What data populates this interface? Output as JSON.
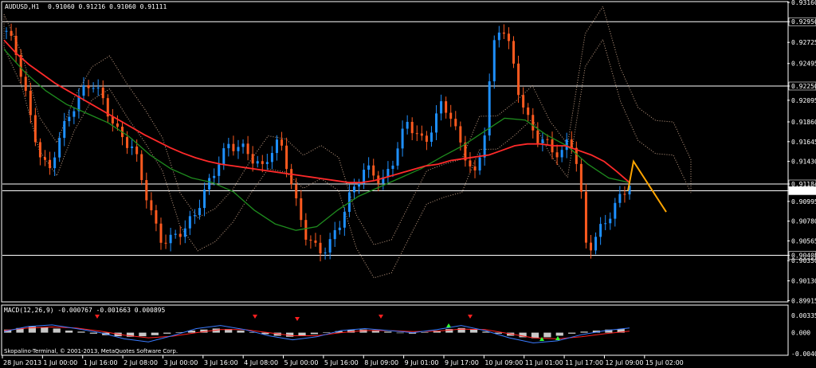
{
  "window": {
    "symbol_title": "AUDUSD,H1",
    "ohlc": "0.91060 0.91216 0.91060 0.91111",
    "macd_title": "MACD(12,26,9) -0.000767 -0.001663 0.000895",
    "copyright": "Skopalino-Terminal, © 2001-2013, MetaQuotes Software Corp."
  },
  "colors": {
    "background": "#000000",
    "candle_bull": "#1E90FF",
    "candle_bear": "#FF5A1F",
    "ma_fast": "#FF2A2A",
    "ma_slow": "#1E8C1E",
    "cloud": "#F4C7A8",
    "projection": "#FFA500",
    "macd_hist": "#C8C8C8",
    "macd_main": "#3A7BFF",
    "macd_signal": "#FF2020",
    "arrow_up": "#33FF33",
    "arrow_down": "#FF2020",
    "grid": "#FFFFFF"
  },
  "chart_data": [
    {
      "type": "candlestick",
      "ylim": [
        0.8991,
        0.9316
      ],
      "y_ticks": [
        "0.93160",
        "0.92950",
        "0.92725",
        "0.92495",
        "0.92250",
        "0.92095",
        "0.91860",
        "0.91645",
        "0.91430",
        "0.91184",
        "0.91111",
        "0.90995",
        "0.90780",
        "0.90565",
        "0.90408",
        "0.90350",
        "0.90130",
        "0.89915"
      ],
      "current_price": 0.91111,
      "horizontal_levels": [
        0.9295,
        0.9225,
        0.91184,
        0.9111,
        0.90408
      ],
      "x_ticks": [
        "28 Jun 2013",
        "1 Jul 00:00",
        "1 Jul 16:00",
        "2 Jul 08:00",
        "3 Jul 00:00",
        "3 Jul 16:00",
        "4 Jul 08:00",
        "5 Jul 00:00",
        "5 Jul 16:00",
        "8 Jul 09:00",
        "9 Jul 01:00",
        "9 Jul 17:00",
        "10 Jul 09:00",
        "11 Jul 01:00",
        "11 Jul 17:00",
        "12 Jul 09:00",
        "15 Jul 02:00"
      ],
      "close_path": [
        0.9285,
        0.9265,
        0.923,
        0.918,
        0.915,
        0.913,
        0.9165,
        0.9185,
        0.9205,
        0.922,
        0.923,
        0.9215,
        0.9195,
        0.9175,
        0.9165,
        0.9155,
        0.912,
        0.9085,
        0.906,
        0.9055,
        0.9065,
        0.907,
        0.9085,
        0.9105,
        0.9125,
        0.9145,
        0.916,
        0.916,
        0.9155,
        0.9145,
        0.9135,
        0.9155,
        0.9165,
        0.9135,
        0.9095,
        0.9065,
        0.905,
        0.9045,
        0.9055,
        0.9075,
        0.91,
        0.912,
        0.9135,
        0.913,
        0.912,
        0.9135,
        0.9165,
        0.9185,
        0.9175,
        0.916,
        0.9185,
        0.9205,
        0.9195,
        0.9165,
        0.9145,
        0.9125,
        0.9175,
        0.9265,
        0.9295,
        0.9265,
        0.922,
        0.919,
        0.917,
        0.9165,
        0.9155,
        0.915,
        0.917,
        0.9135,
        0.9045,
        0.906,
        0.9075,
        0.909,
        0.9105,
        0.912
      ],
      "projection": [
        0.9111,
        0.9143,
        0.9088
      ],
      "ma_fast": [
        0.9275,
        0.926,
        0.9248,
        0.9238,
        0.9228,
        0.922,
        0.9212,
        0.9204,
        0.9196,
        0.9188,
        0.918,
        0.9172,
        0.9165,
        0.9158,
        0.9152,
        0.9147,
        0.9143,
        0.914,
        0.9138,
        0.9136,
        0.9134,
        0.9132,
        0.913,
        0.9128,
        0.9126,
        0.9124,
        0.9122,
        0.912,
        0.912,
        0.9122,
        0.9126,
        0.913,
        0.9134,
        0.9138,
        0.914,
        0.9144,
        0.9146,
        0.9148,
        0.915,
        0.9155,
        0.916,
        0.9162,
        0.9162,
        0.916,
        0.916,
        0.9155,
        0.915,
        0.9143,
        0.9132,
        0.912
      ],
      "ma_slow": [
        0.9265,
        0.924,
        0.922,
        0.9205,
        0.9195,
        0.9185,
        0.917,
        0.915,
        0.9135,
        0.9125,
        0.912,
        0.911,
        0.909,
        0.9075,
        0.9068,
        0.9072,
        0.909,
        0.9105,
        0.9115,
        0.9125,
        0.9135,
        0.9148,
        0.916,
        0.9175,
        0.919,
        0.9188,
        0.9172,
        0.916,
        0.914,
        0.9125,
        0.912
      ]
    },
    {
      "type": "bar",
      "title": "MACD(12,26,9) -0.000767 -0.001663 0.000895",
      "ylim": [
        -0.00409,
        0.00335
      ],
      "y_ticks": [
        "0.00335",
        "0.000",
        "-0.00409"
      ],
      "histogram": [
        0.0006,
        0.0009,
        0.0012,
        0.0011,
        0.0008,
        0.0004,
        0.0002,
        -0.0002,
        -0.0005,
        -0.0007,
        -0.0008,
        -0.0007,
        -0.0005,
        -0.0002,
        0.0001,
        0.0004,
        0.0006,
        0.0008,
        0.0007,
        0.0004,
        0.0001,
        -0.0003,
        -0.0006,
        -0.0008,
        -0.0006,
        -0.0003,
        0.0001,
        0.0003,
        0.0005,
        0.0006,
        0.0005,
        0.0002,
        -0.0001,
        -0.0002,
        0.0001,
        0.0004,
        0.0007,
        0.0009,
        0.0006,
        0.0002,
        -0.0002,
        -0.0006,
        -0.0009,
        -0.0011,
        -0.0009,
        -0.0006,
        -0.0002,
        0.0002,
        0.0004,
        0.0006,
        0.0007
      ],
      "macd_line": [
        0.0002,
        0.0012,
        0.0015,
        0.0008,
        0.0,
        -0.0012,
        -0.0018,
        -0.0006,
        0.0008,
        0.0014,
        0.0006,
        -0.0006,
        -0.0014,
        -0.0008,
        0.0004,
        0.0008,
        0.0004,
        0.0,
        0.0006,
        0.0014,
        0.0004,
        -0.001,
        -0.002,
        -0.0016,
        -0.0004,
        0.0004,
        0.0009
      ],
      "signal_line": [
        0.0004,
        0.0009,
        0.0011,
        0.0009,
        0.0003,
        -0.0005,
        -0.001,
        -0.0007,
        0.0,
        0.0006,
        0.0006,
        0.0,
        -0.0006,
        -0.0006,
        0.0,
        0.0004,
        0.0004,
        0.0002,
        0.0003,
        0.0007,
        0.0006,
        -0.0002,
        -0.001,
        -0.0012,
        -0.0008,
        -0.0002,
        0.0003
      ]
    }
  ]
}
